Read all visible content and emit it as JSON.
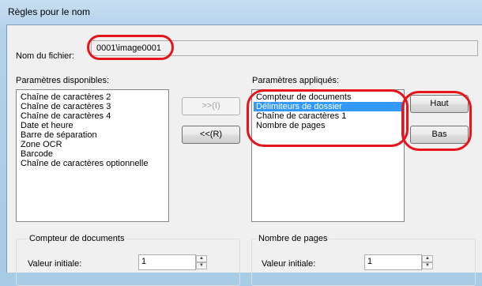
{
  "window": {
    "title": "Règles pour le nom"
  },
  "filename": {
    "label": "Nom du fichier:",
    "value": "0001\\image0001"
  },
  "available": {
    "label": "Paramètres disponibles:",
    "items": [
      "Chaîne de caractères 2",
      "Chaîne de caractères 3",
      "Chaîne de caractères 4",
      "Date et heure",
      "Barre de séparation",
      "Zone OCR",
      "Barcode",
      "Chaîne de caractères optionnelle"
    ]
  },
  "applied": {
    "label": "Paramètres appliqués:",
    "items": [
      "Compteur de documents",
      "Délimiteurs de dossier",
      "Chaîne de caractères 1",
      "Nombre de pages"
    ],
    "selected_index": 1
  },
  "buttons": {
    "add": ">>(I)",
    "remove": "<<(R)",
    "up": "Haut",
    "down": "Bas"
  },
  "counter_group": {
    "title": "Compteur de documents",
    "initial_label": "Valeur initiale:",
    "initial_value": "1"
  },
  "pages_group": {
    "title": "Nombre de pages",
    "initial_label": "Valeur initiale:",
    "initial_value": "1"
  },
  "colors": {
    "highlight_ring": "#e8141b",
    "selection": "#3399ff"
  }
}
